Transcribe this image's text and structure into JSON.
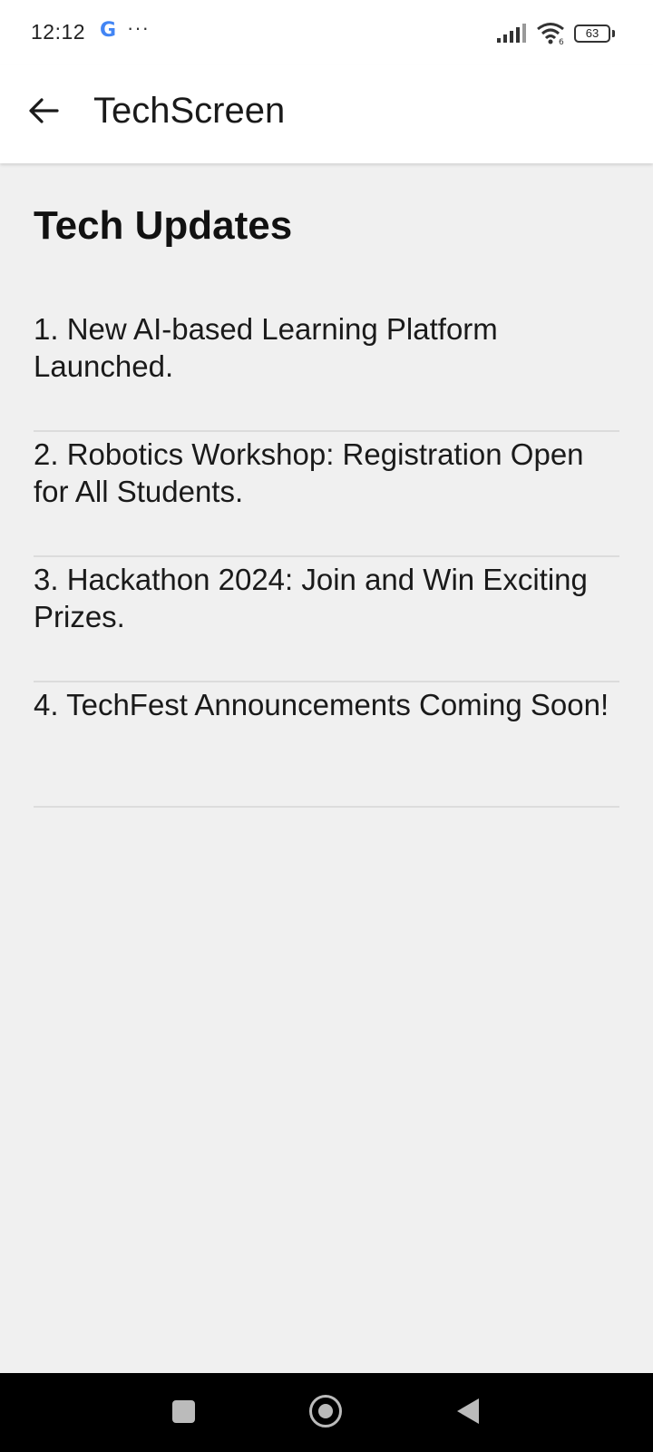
{
  "status_bar": {
    "time": "12:12",
    "google_letter": "G",
    "more": "···",
    "battery_level": "63",
    "icons": [
      "google-icon",
      "more-icon",
      "signal-icon",
      "wifi-icon",
      "battery-icon"
    ]
  },
  "app_bar": {
    "title": "TechScreen",
    "back_icon": "arrow-back-icon"
  },
  "main": {
    "section_title": "Tech Updates",
    "updates": [
      "1. New AI-based Learning Platform Launched.",
      "2. Robotics Workshop: Registration Open for All Students.",
      "3. Hackathon 2024: Join and Win Exciting Prizes.",
      "4. TechFest Announcements Coming Soon!"
    ]
  },
  "nav_bar": {
    "icons": [
      "recent-apps-icon",
      "home-icon",
      "back-triangle-icon"
    ]
  },
  "colors": {
    "background": "#f0f0f0",
    "app_bar": "#ffffff",
    "nav_bar": "#000000",
    "divider": "#dcdcdc"
  }
}
